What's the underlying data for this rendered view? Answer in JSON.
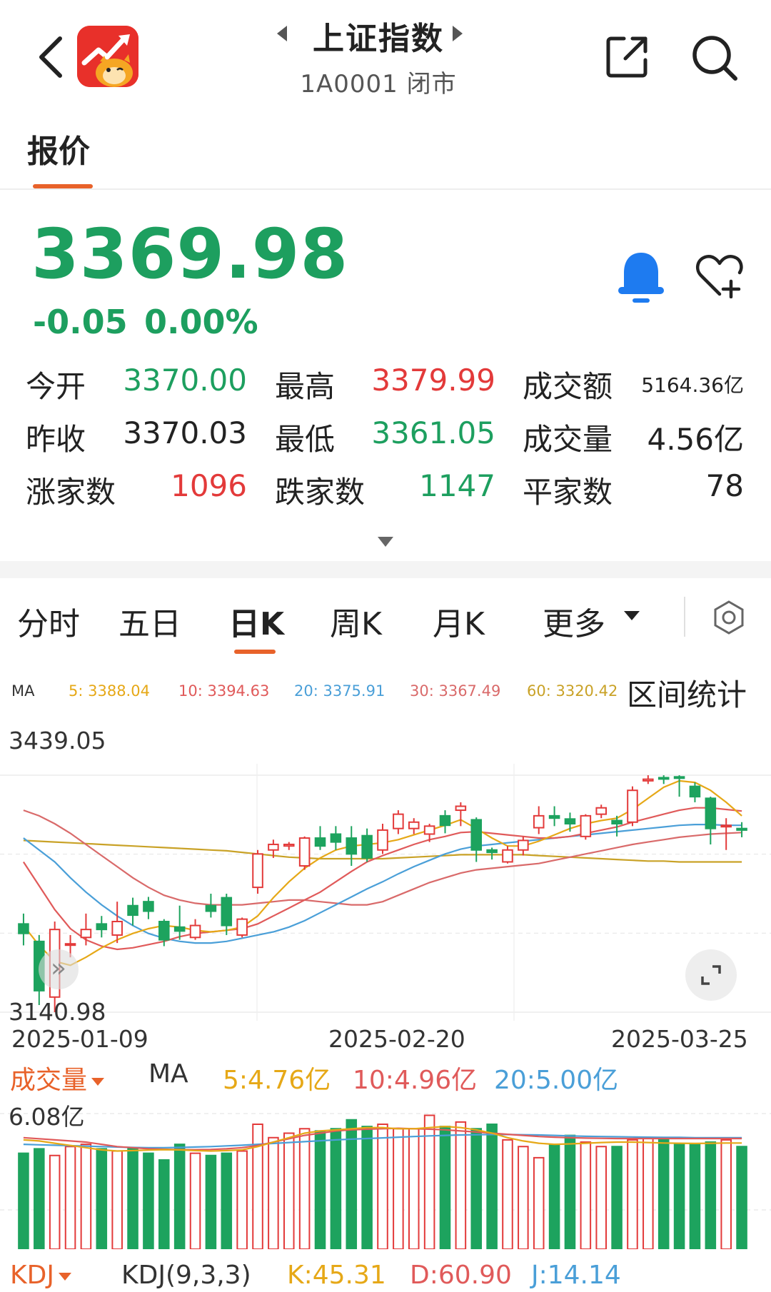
{
  "header": {
    "title": "上证指数",
    "subtitle": "1A0001 闭市"
  },
  "tabs": {
    "quote": "报价"
  },
  "price": {
    "last": "3369.98",
    "change": "-0.05",
    "change_pct": "0.00%"
  },
  "stats": {
    "open_label": "今开",
    "open": "3370.00",
    "high_label": "最高",
    "high": "3379.99",
    "turnover_label": "成交额",
    "turnover": "5164.36亿",
    "prev_close_label": "昨收",
    "prev_close": "3370.03",
    "low_label": "最低",
    "low": "3361.05",
    "volume_label": "成交量",
    "volume": "4.56亿",
    "up_count_label": "涨家数",
    "up_count": "1096",
    "down_count_label": "跌家数",
    "down_count": "1147",
    "flat_count_label": "平家数",
    "flat_count": "78"
  },
  "period_tabs": {
    "intraday": "分时",
    "five_day": "五日",
    "daily_k": "日K",
    "weekly_k": "周K",
    "monthly_k": "月K",
    "more": "更多"
  },
  "ma_legend": {
    "label": "MA",
    "ma5": "5: 3388.04",
    "ma10": "10: 3394.63",
    "ma20": "20: 3375.91",
    "ma30": "30: 3367.49",
    "ma60": "60: 3320.42",
    "range_stat": "区间统计"
  },
  "colors": {
    "up": "#e33a3a",
    "down": "#1da35e",
    "ma5": "#e6a817",
    "ma10": "#e05a5a",
    "ma20": "#4a9fd8",
    "ma30": "#d96a6a",
    "ma60": "#c9a227"
  },
  "chart_data": [
    {
      "type": "candlestick",
      "title": "日K",
      "y_high_label": "3439.05",
      "y_low_label": "3140.98",
      "ylim": [
        3140.98,
        3439.05
      ],
      "x_labels": [
        "2025-01-09",
        "2025-02-20",
        "2025-03-25"
      ],
      "candles": [
        {
          "o": 3252,
          "c": 3240,
          "h": 3265,
          "l": 3225
        },
        {
          "o": 3230,
          "c": 3168,
          "h": 3238,
          "l": 3150
        },
        {
          "o": 3160,
          "c": 3245,
          "h": 3255,
          "l": 3141
        },
        {
          "o": 3226,
          "c": 3227,
          "h": 3238,
          "l": 3210
        },
        {
          "o": 3235,
          "c": 3245,
          "h": 3265,
          "l": 3225
        },
        {
          "o": 3252,
          "c": 3245,
          "h": 3262,
          "l": 3235
        },
        {
          "o": 3238,
          "c": 3255,
          "h": 3280,
          "l": 3228
        },
        {
          "o": 3275,
          "c": 3263,
          "h": 3285,
          "l": 3250
        },
        {
          "o": 3280,
          "c": 3268,
          "h": 3286,
          "l": 3258
        },
        {
          "o": 3255,
          "c": 3232,
          "h": 3258,
          "l": 3224
        },
        {
          "o": 3248,
          "c": 3243,
          "h": 3275,
          "l": 3232
        },
        {
          "o": 3235,
          "c": 3250,
          "h": 3258,
          "l": 3232
        },
        {
          "o": 3275,
          "c": 3268,
          "h": 3290,
          "l": 3260
        },
        {
          "o": 3285,
          "c": 3250,
          "h": 3290,
          "l": 3238
        },
        {
          "o": 3238,
          "c": 3258,
          "h": 3260,
          "l": 3235
        },
        {
          "o": 3298,
          "c": 3340,
          "h": 3345,
          "l": 3290
        },
        {
          "o": 3345,
          "c": 3352,
          "h": 3358,
          "l": 3335
        },
        {
          "o": 3350,
          "c": 3352,
          "h": 3355,
          "l": 3345
        },
        {
          "o": 3325,
          "c": 3360,
          "h": 3362,
          "l": 3320
        },
        {
          "o": 3360,
          "c": 3350,
          "h": 3375,
          "l": 3345
        },
        {
          "o": 3365,
          "c": 3355,
          "h": 3375,
          "l": 3345
        },
        {
          "o": 3360,
          "c": 3340,
          "h": 3375,
          "l": 3325
        },
        {
          "o": 3363,
          "c": 3335,
          "h": 3372,
          "l": 3330
        },
        {
          "o": 3345,
          "c": 3370,
          "h": 3378,
          "l": 3340
        },
        {
          "o": 3372,
          "c": 3390,
          "h": 3395,
          "l": 3365
        },
        {
          "o": 3372,
          "c": 3380,
          "h": 3385,
          "l": 3365
        },
        {
          "o": 3365,
          "c": 3375,
          "h": 3378,
          "l": 3355
        },
        {
          "o": 3388,
          "c": 3376,
          "h": 3395,
          "l": 3366
        },
        {
          "o": 3395,
          "c": 3400,
          "h": 3405,
          "l": 3375
        },
        {
          "o": 3383,
          "c": 3345,
          "h": 3386,
          "l": 3330
        },
        {
          "o": 3345,
          "c": 3342,
          "h": 3348,
          "l": 3333
        },
        {
          "o": 3330,
          "c": 3345,
          "h": 3350,
          "l": 3328
        },
        {
          "o": 3345,
          "c": 3357,
          "h": 3362,
          "l": 3338
        },
        {
          "o": 3373,
          "c": 3388,
          "h": 3400,
          "l": 3365
        },
        {
          "o": 3388,
          "c": 3385,
          "h": 3400,
          "l": 3375
        },
        {
          "o": 3384,
          "c": 3378,
          "h": 3392,
          "l": 3368
        },
        {
          "o": 3362,
          "c": 3388,
          "h": 3390,
          "l": 3358
        },
        {
          "o": 3390,
          "c": 3398,
          "h": 3402,
          "l": 3385
        },
        {
          "o": 3382,
          "c": 3378,
          "h": 3388,
          "l": 3362
        },
        {
          "o": 3380,
          "c": 3420,
          "h": 3425,
          "l": 3375
        },
        {
          "o": 3432,
          "c": 3434,
          "h": 3439,
          "l": 3428
        },
        {
          "o": 3436,
          "c": 3435,
          "h": 3439,
          "l": 3428
        },
        {
          "o": 3437,
          "c": 3436,
          "h": 3439,
          "l": 3412
        },
        {
          "o": 3425,
          "c": 3412,
          "h": 3430,
          "l": 3405
        },
        {
          "o": 3410,
          "c": 3372,
          "h": 3412,
          "l": 3352
        },
        {
          "o": 3375,
          "c": 3376,
          "h": 3385,
          "l": 3345
        },
        {
          "o": 3372,
          "c": 3370,
          "h": 3380,
          "l": 3361
        }
      ],
      "ma5": [
        3250,
        3225,
        3205,
        3200,
        3210,
        3222,
        3232,
        3240,
        3246,
        3250,
        3248,
        3244,
        3242,
        3244,
        3248,
        3262,
        3285,
        3305,
        3322,
        3335,
        3345,
        3350,
        3352,
        3354,
        3358,
        3364,
        3370,
        3376,
        3383,
        3372,
        3360,
        3350,
        3350,
        3356,
        3364,
        3372,
        3378,
        3382,
        3385,
        3396,
        3410,
        3424,
        3432,
        3430,
        3420,
        3405,
        3388
      ],
      "ma10": [
        3330,
        3300,
        3270,
        3246,
        3232,
        3224,
        3220,
        3222,
        3226,
        3230,
        3236,
        3240,
        3242,
        3244,
        3246,
        3252,
        3262,
        3272,
        3282,
        3292,
        3305,
        3318,
        3330,
        3338,
        3345,
        3352,
        3358,
        3362,
        3367,
        3368,
        3366,
        3364,
        3362,
        3360,
        3360,
        3362,
        3366,
        3370,
        3374,
        3380,
        3385,
        3390,
        3395,
        3398,
        3398,
        3396,
        3394
      ],
      "ma20": [
        3360,
        3345,
        3330,
        3310,
        3292,
        3276,
        3262,
        3250,
        3240,
        3234,
        3230,
        3228,
        3228,
        3230,
        3234,
        3238,
        3242,
        3248,
        3256,
        3266,
        3276,
        3286,
        3296,
        3305,
        3315,
        3324,
        3332,
        3340,
        3346,
        3350,
        3352,
        3354,
        3356,
        3358,
        3360,
        3362,
        3364,
        3366,
        3368,
        3370,
        3372,
        3374,
        3376,
        3377,
        3377,
        3376,
        3376
      ],
      "ma30": [
        3395,
        3388,
        3378,
        3366,
        3352,
        3338,
        3324,
        3310,
        3298,
        3288,
        3282,
        3278,
        3276,
        3276,
        3276,
        3278,
        3280,
        3282,
        3282,
        3280,
        3278,
        3276,
        3276,
        3280,
        3288,
        3296,
        3304,
        3310,
        3316,
        3320,
        3322,
        3324,
        3326,
        3328,
        3332,
        3336,
        3340,
        3344,
        3348,
        3352,
        3355,
        3358,
        3361,
        3363,
        3365,
        3366,
        3367
      ],
      "ma60": [
        3357,
        3356,
        3355,
        3354,
        3353,
        3352,
        3351,
        3350,
        3349,
        3348,
        3347,
        3346,
        3345,
        3344,
        3342,
        3340,
        3338,
        3336,
        3335,
        3334,
        3334,
        3334,
        3334,
        3334,
        3335,
        3336,
        3337,
        3338,
        3339,
        3339,
        3339,
        3339,
        3339,
        3338,
        3337,
        3336,
        3335,
        3334,
        3333,
        3332,
        3331,
        3331,
        3330,
        3330,
        3330,
        3330,
        3330
      ]
    },
    {
      "type": "bar",
      "title": "成交量",
      "y_max_label": "6.08亿",
      "ylim": [
        0,
        6.08
      ],
      "legend": {
        "label": "成交量",
        "ma": "MA",
        "ma5": "5:4.76亿",
        "ma10": "10:4.96亿",
        "ma20": "20:5.00亿"
      },
      "values": [
        4.3,
        4.5,
        4.2,
        4.6,
        4.7,
        4.5,
        4.4,
        4.5,
        4.3,
        4.0,
        4.7,
        4.3,
        4.2,
        4.3,
        4.4,
        5.6,
        5.0,
        5.2,
        5.4,
        5.3,
        5.4,
        5.8,
        5.5,
        5.6,
        5.4,
        5.4,
        6.0,
        5.5,
        5.7,
        5.4,
        5.6,
        4.9,
        4.6,
        4.1,
        4.7,
        5.1,
        4.8,
        4.6,
        4.6,
        4.9,
        5.0,
        4.9,
        4.7,
        4.7,
        4.8,
        4.9,
        4.6
      ],
      "ma5": [
        4.9,
        4.85,
        4.75,
        4.65,
        4.55,
        4.45,
        4.4,
        4.42,
        4.44,
        4.46,
        4.45,
        4.42,
        4.4,
        4.42,
        4.45,
        4.6,
        4.8,
        5.0,
        5.2,
        5.3,
        5.35,
        5.4,
        5.45,
        5.45,
        5.4,
        5.4,
        5.45,
        5.5,
        5.45,
        5.35,
        5.2,
        5.0,
        4.85,
        4.75,
        4.7,
        4.72,
        4.75,
        4.78,
        4.8,
        4.8,
        4.78,
        4.76,
        4.75,
        4.74,
        4.75,
        4.76,
        4.76
      ],
      "ma10": [
        5.0,
        4.95,
        4.9,
        4.85,
        4.8,
        4.7,
        4.6,
        4.55,
        4.5,
        4.48,
        4.46,
        4.46,
        4.47,
        4.5,
        4.55,
        4.65,
        4.8,
        4.95,
        5.1,
        5.2,
        5.3,
        5.35,
        5.38,
        5.4,
        5.42,
        5.4,
        5.38,
        5.35,
        5.3,
        5.25,
        5.2,
        5.15,
        5.1,
        5.05,
        5.02,
        5.0,
        4.98,
        4.97,
        4.96,
        4.96,
        4.96,
        4.96,
        4.96,
        4.96,
        4.96,
        4.96,
        4.96
      ],
      "ma20": [
        4.7,
        4.68,
        4.66,
        4.64,
        4.62,
        4.6,
        4.58,
        4.56,
        4.55,
        4.55,
        4.56,
        4.58,
        4.6,
        4.63,
        4.66,
        4.7,
        4.74,
        4.78,
        4.82,
        4.86,
        4.9,
        4.93,
        4.96,
        4.99,
        5.02,
        5.05,
        5.08,
        5.1,
        5.12,
        5.13,
        5.14,
        5.14,
        5.13,
        5.12,
        5.1,
        5.08,
        5.06,
        5.05,
        5.04,
        5.03,
        5.02,
        5.01,
        5.01,
        5.0,
        5.0,
        5.0,
        5.0
      ]
    }
  ],
  "kdj": {
    "label": "KDJ",
    "params": "KDJ(9,3,3)",
    "k": "K:45.31",
    "d": "D:60.90",
    "j": "J:14.14"
  }
}
